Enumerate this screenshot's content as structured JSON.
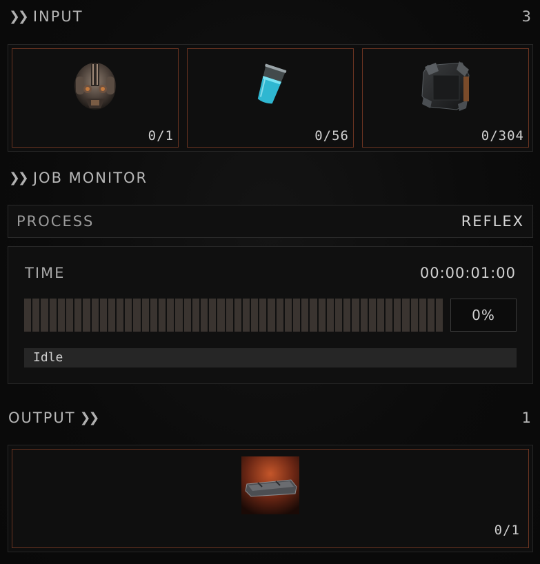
{
  "input": {
    "title": "INPUT",
    "count": "3",
    "slots": [
      {
        "icon": "mechanical-helmet-icon",
        "quantity": "0/1"
      },
      {
        "icon": "blue-liquid-beaker-icon",
        "quantity": "0/56"
      },
      {
        "icon": "dark-armor-plate-icon",
        "quantity": "0/304"
      }
    ]
  },
  "job_monitor": {
    "title": "JOB MONITOR",
    "process_label": "PROCESS",
    "process_value": "REFLEX",
    "time_label": "TIME",
    "time_value": "00:00:01:00",
    "progress_percent": "0%",
    "progress_fraction": 0,
    "status": "Idle"
  },
  "output": {
    "title": "OUTPUT",
    "count": "1",
    "slots": [
      {
        "icon": "metal-plate-blueprint-icon",
        "quantity": "0/1"
      }
    ]
  },
  "colors": {
    "slot_border": "#6b3421",
    "progress_segment": "#3a3430",
    "background": "#0c0c0c"
  }
}
